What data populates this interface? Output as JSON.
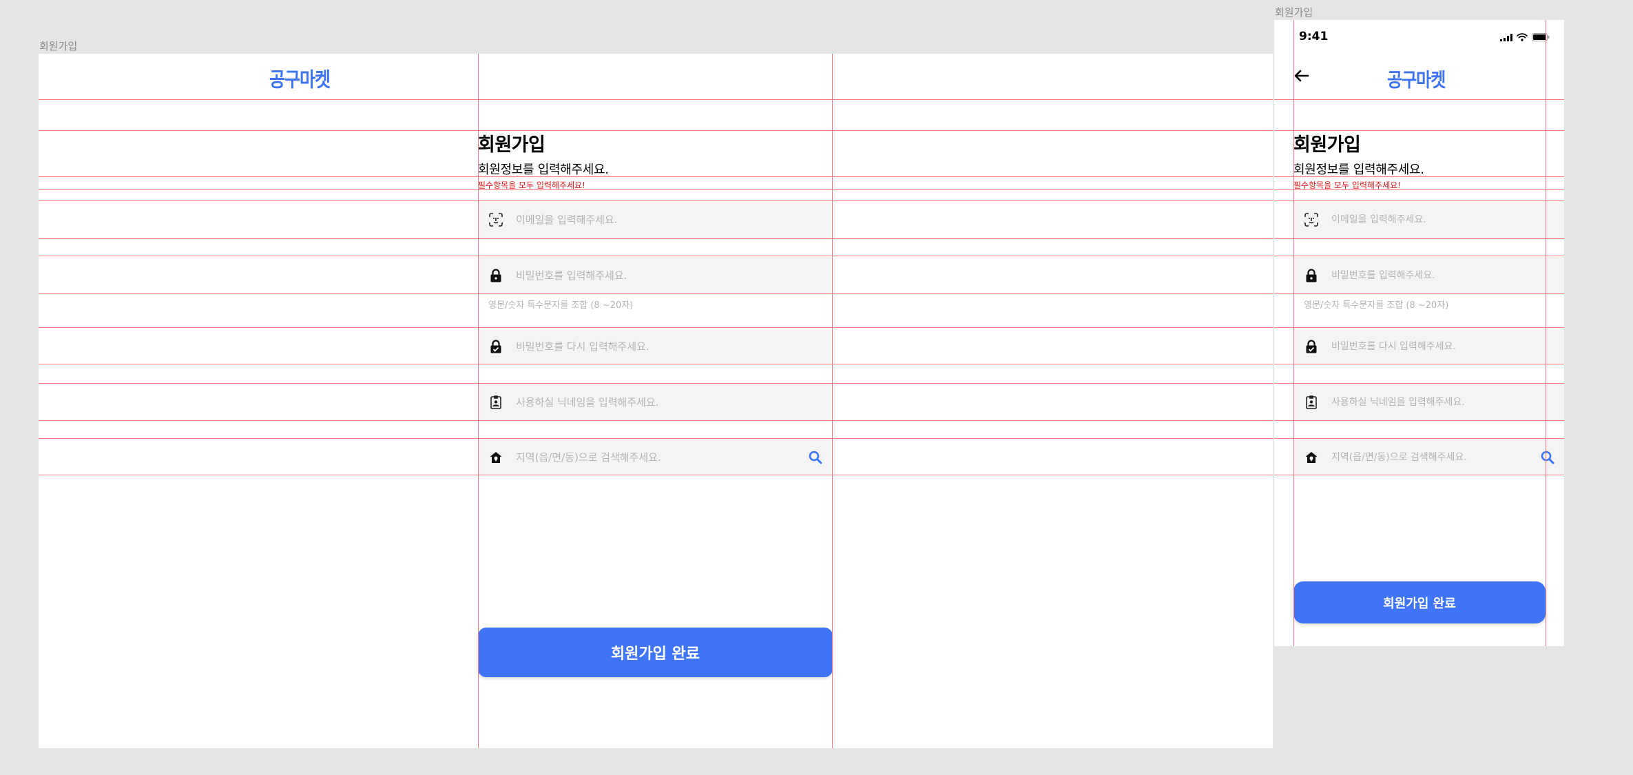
{
  "desktop": {
    "frame_label": "회원가입",
    "logo": "공구마켓",
    "title": "회원가입",
    "subtitle": "회원정보를 입력해주세요.",
    "warning": "필수항목을 모두 입력해주세요!",
    "email_placeholder": "이메일을 입력해주세요.",
    "password_placeholder": "비밀번호를 입력해주세요.",
    "password_hint": "영문/숫자 특수문자를 조합 (8 ~20자)",
    "password_confirm_placeholder": "비밀번호를 다시 입력해주세요.",
    "nickname_placeholder": "사용하실 닉네임을 입력해주세요.",
    "region_placeholder": "지역(읍/면/동)으로 검색해주세요.",
    "submit_label": "회원가입 완료"
  },
  "mobile": {
    "frame_label": "회원가입",
    "status_time": "9:41",
    "logo": "공구마켓",
    "title": "회원가입",
    "subtitle": "회원정보를 입력해주세요.",
    "warning": "필수항목을 모두 입력해주세요!",
    "email_placeholder": "이메일을 입력해주세요.",
    "password_placeholder": "비밀번호를 입력해주세요.",
    "password_hint": "영문/숫자 특수문자를 조합 (8 ~20자)",
    "password_confirm_placeholder": "비밀번호를 다시 입력해주세요.",
    "nickname_placeholder": "사용하실 닉네임을 입력해주세요.",
    "region_placeholder": "지역(읍/면/동)으로 검색해주세요.",
    "submit_label": "회원가입 완료"
  },
  "icons": {
    "email": "face-id-icon",
    "password": "lock-icon",
    "password_confirm": "lock-check-icon",
    "nickname": "id-badge-icon",
    "region": "home-location-icon",
    "search": "search-icon",
    "back": "back-arrow-icon"
  },
  "colors": {
    "brand": "#3d73f5",
    "button": "#3f74f7",
    "warning": "#e02020",
    "field_bg": "#f4f4f4",
    "guide": "#ff7b7b",
    "canvas": "#e5e5e5"
  }
}
